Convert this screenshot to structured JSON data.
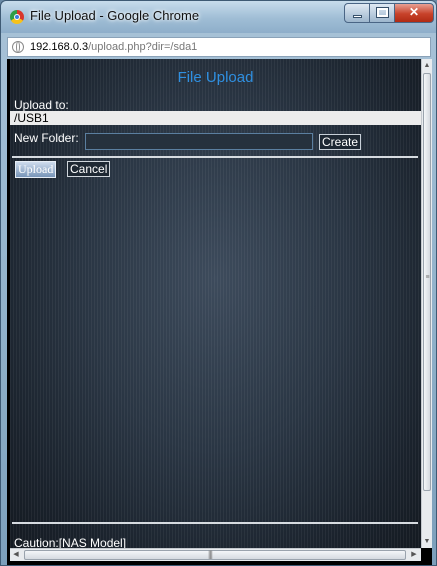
{
  "window": {
    "title": "File Upload - Google Chrome",
    "minimize_icon": "minimize-icon",
    "maximize_icon": "maximize-icon",
    "close_icon": "close-icon"
  },
  "address_bar": {
    "icon": "globe-icon",
    "host": "192.168.0.3",
    "path": "/upload.php?dir=/sda1"
  },
  "page": {
    "title": "File Upload",
    "upload_to_label": "Upload to:",
    "upload_to_value": "/USB1",
    "new_folder_label": "New Folder:",
    "new_folder_value": "",
    "create_label": "Create",
    "upload_label": "Upload",
    "cancel_label": "Cancel",
    "caution_text": "Caution:[NAS Model]"
  },
  "colors": {
    "title_blue": "#2f8fe0",
    "page_background": "#2a3644",
    "upload_button_fill": "#7795b8"
  }
}
